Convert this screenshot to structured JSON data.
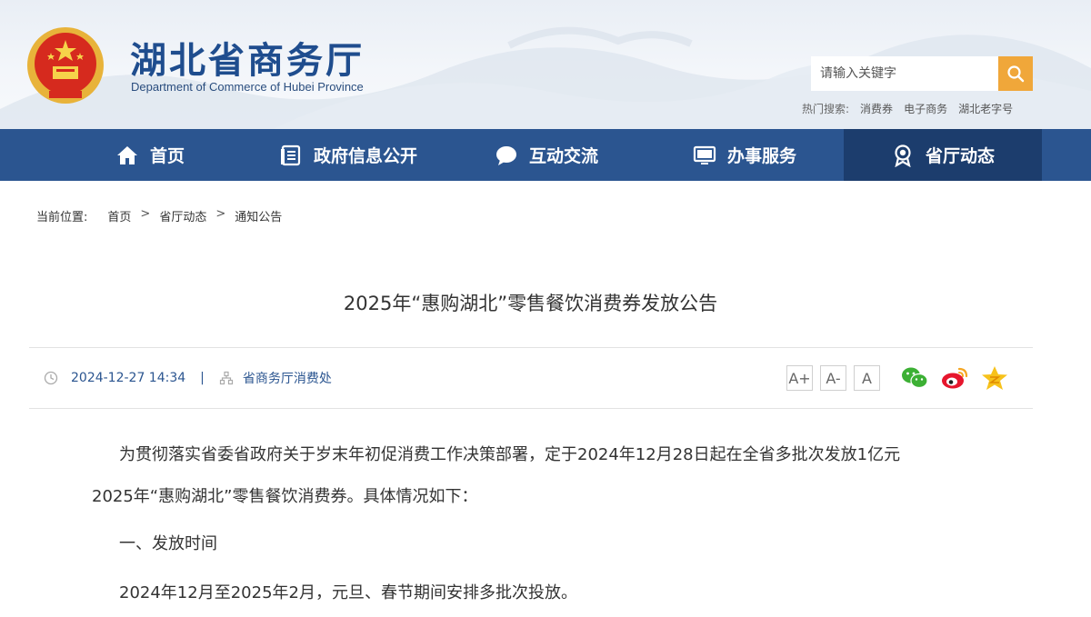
{
  "header": {
    "title": "湖北省商务厅",
    "subtitle": "Department of Commerce of Hubei Province",
    "search_placeholder": "请输入关键字",
    "hot_label": "热门搜索:",
    "hot_items": [
      "消费券",
      "电子商务",
      "湖北老字号"
    ]
  },
  "nav": {
    "items": [
      {
        "label": "首页",
        "icon": "home-icon"
      },
      {
        "label": "政府信息公开",
        "icon": "document-list-icon"
      },
      {
        "label": "互动交流",
        "icon": "chat-bubble-icon"
      },
      {
        "label": "办事服务",
        "icon": "monitor-icon"
      },
      {
        "label": "省厅动态",
        "icon": "award-badge-icon"
      }
    ],
    "active_index": 4
  },
  "breadcrumb": {
    "label": "当前位置:",
    "items": [
      "首页",
      "省厅动态",
      "通知公告"
    ],
    "separator": ">"
  },
  "article": {
    "title": "2025年“惠购湖北”零售餐饮消费券发放公告",
    "date": "2024-12-27 14:34",
    "source": "省商务厅消费处",
    "font_controls": [
      "A+",
      "A-",
      "A"
    ],
    "paragraph1_line1": "为贯彻落实省委省政府关于岁末年初促消费工作决策部署，定于2024年12月28日起在全省多批次发放1亿元",
    "paragraph1_line2": "2025年“惠购湖北”零售餐饮消费券。具体情况如下：",
    "section1_heading": "一、发放时间",
    "section1_text": "2024年12月至2025年2月，元旦、春节期间安排多批次投放。"
  },
  "colors": {
    "nav_bg": "#2b5590",
    "nav_active": "#1c3d6d",
    "title_blue": "#1f4d8e",
    "search_btn": "#f0a73a"
  }
}
